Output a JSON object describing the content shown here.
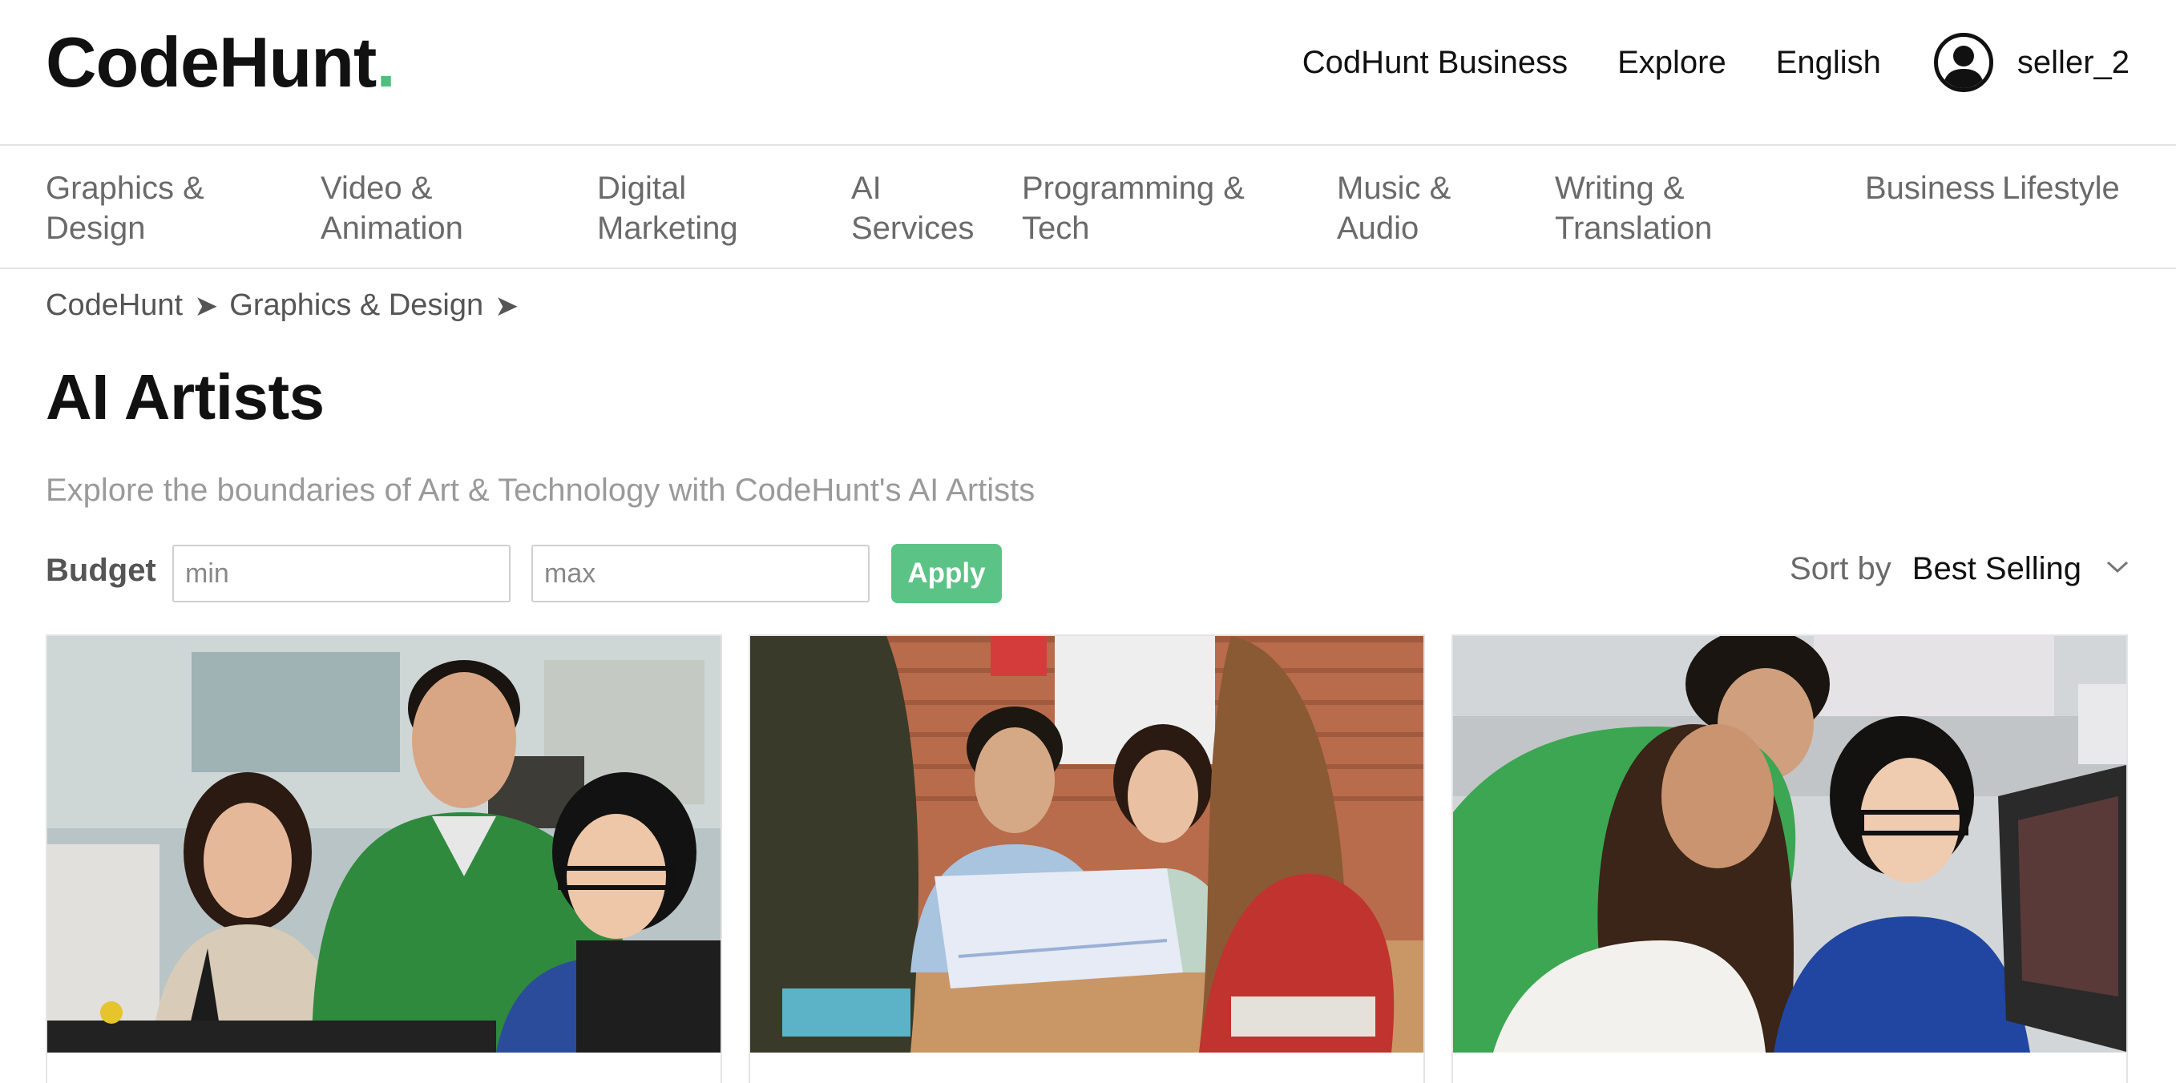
{
  "header": {
    "logo_text": "CodeHunt",
    "logo_dot": ".",
    "links": {
      "business": "CodHunt Business",
      "explore": "Explore",
      "language": "English"
    },
    "username": "seller_2",
    "avatar_icon": "user-circle-icon"
  },
  "categories": [
    {
      "line1": "Graphics &",
      "line2": "Design"
    },
    {
      "line1": "Video &",
      "line2": "Animation"
    },
    {
      "line1": "Digital",
      "line2": "Marketing"
    },
    {
      "line1": "AI",
      "line2": "Services"
    },
    {
      "line1": "Programming &",
      "line2": "Tech"
    },
    {
      "line1": "Music &",
      "line2": "Audio"
    },
    {
      "line1": "Writing &",
      "line2": "Translation"
    },
    {
      "line1": "Business",
      "line2": ""
    },
    {
      "line1": "Lifestyle",
      "line2": ""
    }
  ],
  "breadcrumb": {
    "items": [
      "CodeHunt",
      "Graphics & Design"
    ],
    "separator": "➤"
  },
  "page": {
    "title": "AI Artists",
    "subtitle": "Explore the boundaries of Art & Technology with CodeHunt's AI Artists"
  },
  "filters": {
    "budget_label": "Budget",
    "min_placeholder": "min",
    "max_placeholder": "max",
    "min_value": "",
    "max_value": "",
    "apply_label": "Apply",
    "sort_label": "Sort by",
    "sort_value": "Best Selling",
    "sort_icon": "chevron-down-icon"
  },
  "colors": {
    "accent": "#4fbf7d",
    "apply_button": "#5cc387",
    "muted_text": "#6a6a6a"
  },
  "cards": [
    {
      "image": "office-team-at-monitor-photo"
    },
    {
      "image": "team-reviewing-blueprints-photo"
    },
    {
      "image": "team-working-at-computer-photo"
    }
  ]
}
